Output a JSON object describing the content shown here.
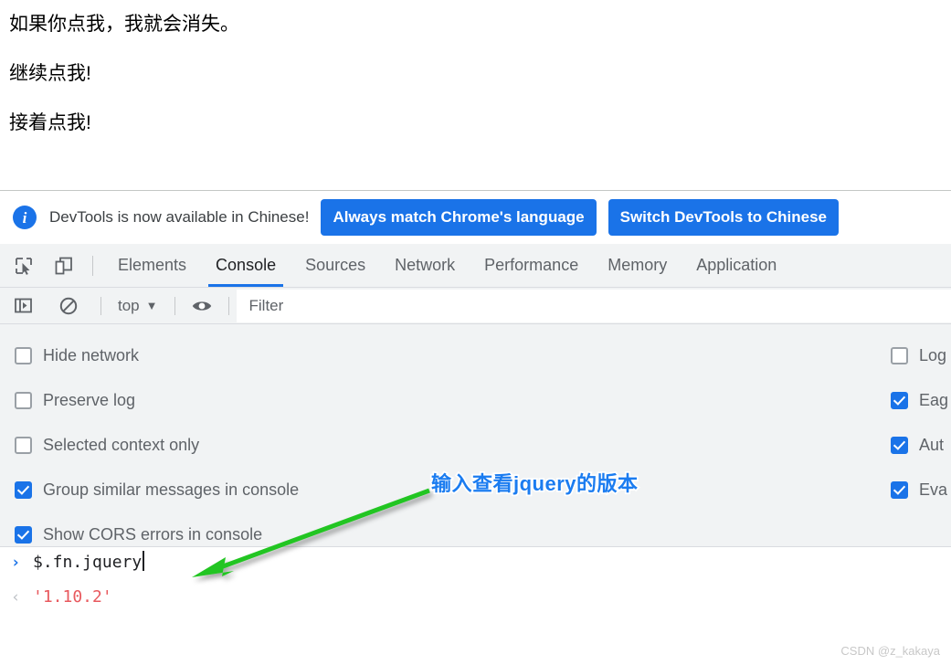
{
  "page": {
    "lines": [
      "如果你点我，我就会消失。",
      "继续点我!",
      "接着点我!"
    ]
  },
  "devtools": {
    "infobar": {
      "icon": "info-icon",
      "message": "DevTools is now available in Chinese!",
      "buttons": [
        {
          "label": "Always match Chrome's language"
        },
        {
          "label": "Switch DevTools to Chinese"
        }
      ]
    },
    "tabstrip": {
      "icons": [
        {
          "name": "inspect-element-icon"
        },
        {
          "name": "device-toolbar-icon"
        }
      ],
      "tabs": [
        {
          "label": "Elements",
          "selected": false
        },
        {
          "label": "Console",
          "selected": true
        },
        {
          "label": "Sources",
          "selected": false
        },
        {
          "label": "Network",
          "selected": false
        },
        {
          "label": "Performance",
          "selected": false
        },
        {
          "label": "Memory",
          "selected": false
        },
        {
          "label": "Application",
          "selected": false
        }
      ]
    },
    "console_toolbar": {
      "sidebar_toggle_icon": "console-sidebar-icon",
      "clear_console_icon": "clear-console-icon",
      "context": "top",
      "context_caret": "▼",
      "eye_icon": "live-expression-eye-icon",
      "filter_placeholder": "Filter",
      "filter_value": ""
    },
    "settings": {
      "left": [
        {
          "label": "Hide network",
          "checked": false
        },
        {
          "label": "Preserve log",
          "checked": false
        },
        {
          "label": "Selected context only",
          "checked": false
        },
        {
          "label": "Group similar messages in console",
          "checked": true
        },
        {
          "label": "Show CORS errors in console",
          "checked": true
        }
      ],
      "right": [
        {
          "label": "Log",
          "checked": false
        },
        {
          "label": "Eag",
          "checked": true
        },
        {
          "label": "Aut",
          "checked": true
        },
        {
          "label": "Eva",
          "checked": true
        }
      ]
    },
    "console": {
      "input_prompt": "›",
      "input_value": "$.fn.jquery",
      "output_prompt": "‹",
      "output_value": "'1.10.2'"
    }
  },
  "annotation": {
    "text": "输入查看jquery的版本",
    "arrow_color": "#22c522"
  },
  "watermark": "CSDN @z_kakaya",
  "colors": {
    "accent": "#1a73e8",
    "panel_bg": "#f1f3f4",
    "annotation_blue": "#1b7cf0",
    "output_red": "#e8595e",
    "arrow_green": "#22c522"
  }
}
